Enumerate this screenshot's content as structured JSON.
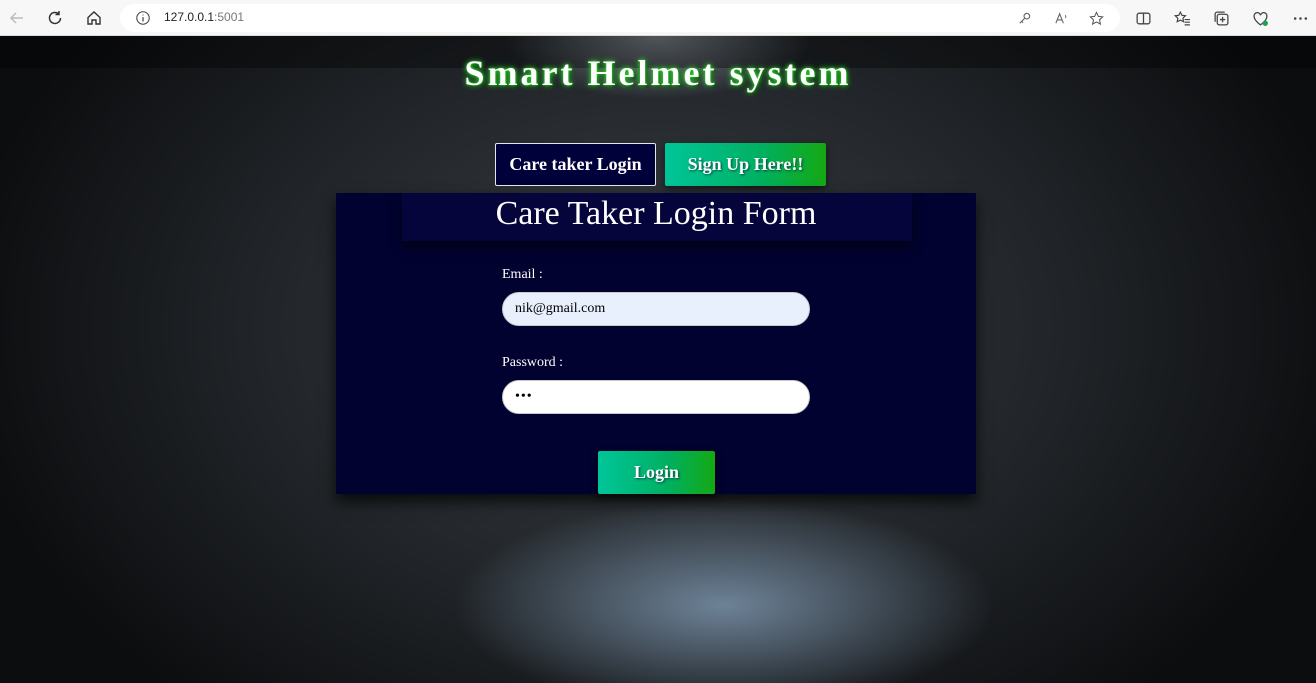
{
  "browser": {
    "url_host": "127.0.0.1",
    "url_port": ":5001",
    "icons": [
      "back-icon",
      "refresh-icon",
      "home-icon",
      "info-icon",
      "key-icon",
      "read-aloud-icon",
      "favorite-star-icon",
      "split-screen-icon",
      "favorites-icon",
      "collections-icon",
      "browser-essentials-icon",
      "more-icon"
    ]
  },
  "header": {
    "title": "Smart Helmet system"
  },
  "nav": {
    "caretaker_login": "Care taker Login",
    "signup": "Sign Up Here!!"
  },
  "form": {
    "title": "Care Taker Login Form",
    "email_label": "Email :",
    "email_value": "nik@gmail.com",
    "password_label": "Password :",
    "password_value": "•••",
    "login_button": "Login"
  },
  "colors": {
    "panel": "#020230",
    "button_gradient_start": "#00c59a",
    "button_gradient_end": "#14a814",
    "title_glow": "#2bff2b"
  }
}
